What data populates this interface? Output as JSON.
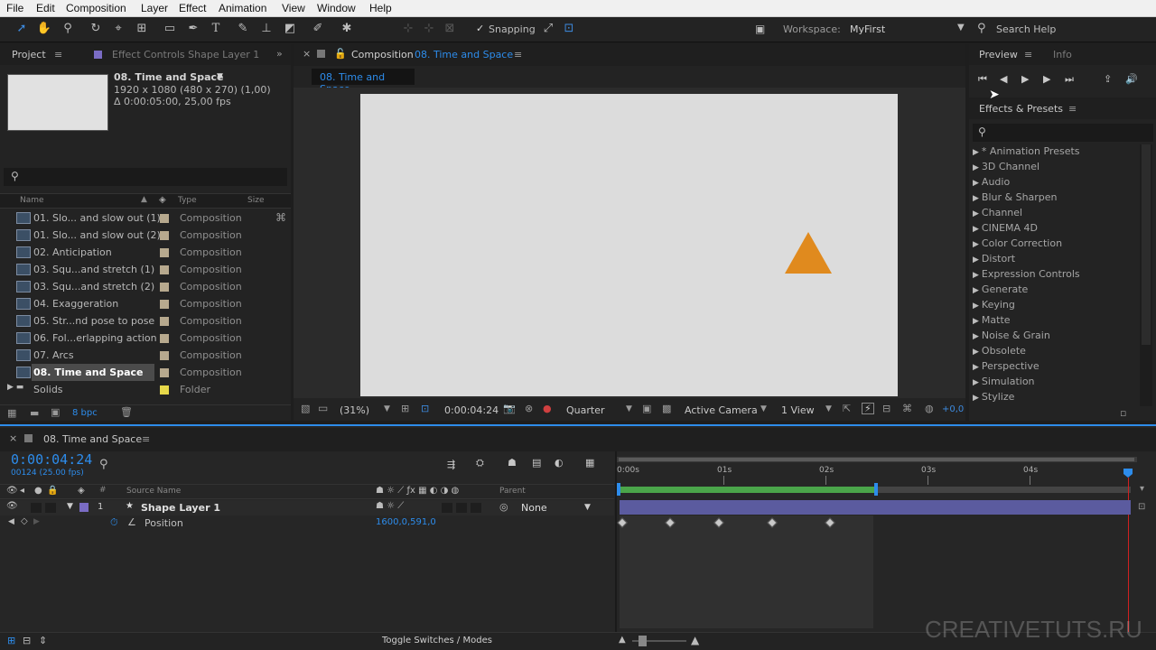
{
  "menu": [
    "File",
    "Edit",
    "Composition",
    "Layer",
    "Effect",
    "Animation",
    "View",
    "Window",
    "Help"
  ],
  "toolbar": {
    "snapping_label": "Snapping",
    "workspace_label": "Workspace:",
    "workspace_value": "MyFirst",
    "search_help": "Search Help"
  },
  "project": {
    "tab": "Project",
    "effect_controls_tab": "Effect Controls Shape Layer 1",
    "comp_name": "08. Time and Space",
    "comp_info1": "1920 x 1080  (480 x 270) (1,00)",
    "comp_info2": "Δ 0:00:05:00, 25,00 fps",
    "col_name": "Name",
    "col_type": "Type",
    "col_size": "Size",
    "items": [
      {
        "name": "01. Slo... and slow out (1)",
        "type": "Composition"
      },
      {
        "name": "01. Slo... and slow out (2)",
        "type": "Composition"
      },
      {
        "name": "02. Anticipation",
        "type": "Composition"
      },
      {
        "name": "03. Squ...and stretch (1)",
        "type": "Composition"
      },
      {
        "name": "03. Squ...and stretch (2)",
        "type": "Composition"
      },
      {
        "name": "04. Exaggeration",
        "type": "Composition"
      },
      {
        "name": "05. Str...nd pose to pose",
        "type": "Composition"
      },
      {
        "name": "06. Fol...erlapping action",
        "type": "Composition"
      },
      {
        "name": "07. Arcs",
        "type": "Composition"
      },
      {
        "name": "08. Time and Space",
        "type": "Composition"
      },
      {
        "name": "Solids",
        "type": "Folder"
      }
    ],
    "bpc": "8 bpc"
  },
  "composition": {
    "tab_prefix": "Composition",
    "tab_name": "08. Time and Space",
    "subtab": "08. Time and Space",
    "zoom": "(31%)",
    "timecode": "0:00:04:24",
    "resolution": "Quarter",
    "camera": "Active Camera",
    "views": "1 View",
    "exposure": "+0,0"
  },
  "preview": {
    "tab": "Preview",
    "info_tab": "Info"
  },
  "effects": {
    "title": "Effects & Presets",
    "items": [
      "* Animation Presets",
      "3D Channel",
      "Audio",
      "Blur & Sharpen",
      "Channel",
      "CINEMA 4D",
      "Color Correction",
      "Distort",
      "Expression Controls",
      "Generate",
      "Keying",
      "Matte",
      "Noise & Grain",
      "Obsolete",
      "Perspective",
      "Simulation",
      "Stylize"
    ]
  },
  "timeline": {
    "tab": "08. Time and Space",
    "timecode": "0:00:04:24",
    "frames": "00124 (25.00 fps)",
    "col_source": "Source Name",
    "col_parent": "Parent",
    "layer_num": "1",
    "layer_name": "Shape Layer 1",
    "parent_value": "None",
    "prop_name": "Position",
    "prop_value": "1600,0,591,0",
    "ruler": [
      "0:00s",
      "01s",
      "02s",
      "03s",
      "04s"
    ],
    "toggle": "Toggle Switches / Modes"
  },
  "watermark": "CREATIVETUTS.RU",
  "colors": {
    "accent": "#2d8ceb",
    "triangle": "#e08a1e",
    "layer_bar": "#5b5b9f",
    "work_area": "#4aa54a"
  }
}
